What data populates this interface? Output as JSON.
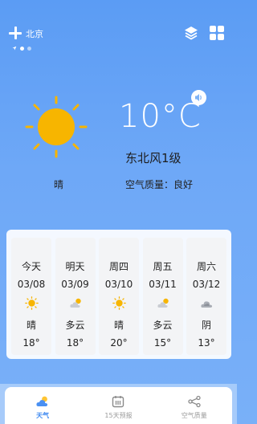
{
  "header": {
    "city": "北京",
    "page_count": 3,
    "active_page": 1
  },
  "current": {
    "temperature": "10°C",
    "wind": "东北风1级",
    "condition": "晴",
    "air_quality": "空气质量：良好",
    "icon": "sun-icon"
  },
  "forecast": [
    {
      "label": "今天",
      "date": "03/08",
      "condition": "晴",
      "temp": "18°",
      "icon": "sun-icon"
    },
    {
      "label": "明天",
      "date": "03/09",
      "condition": "多云",
      "temp": "18°",
      "icon": "partly-cloudy-icon"
    },
    {
      "label": "周四",
      "date": "03/10",
      "condition": "晴",
      "temp": "20°",
      "icon": "sun-icon"
    },
    {
      "label": "周五",
      "date": "03/11",
      "condition": "多云",
      "temp": "15°",
      "icon": "partly-cloudy-icon"
    },
    {
      "label": "周六",
      "date": "03/12",
      "condition": "阴",
      "temp": "13°",
      "icon": "overcast-icon"
    }
  ],
  "tabs": [
    {
      "label": "天气",
      "icon": "weather-tab-icon",
      "active": true
    },
    {
      "label": "15天预报",
      "icon": "calendar-icon",
      "active": false
    },
    {
      "label": "空气质量",
      "icon": "share-nodes-icon",
      "active": false
    }
  ],
  "colors": {
    "background": "#6ea8f7",
    "sun": "#f7b500",
    "accent": "#3a87f0"
  }
}
